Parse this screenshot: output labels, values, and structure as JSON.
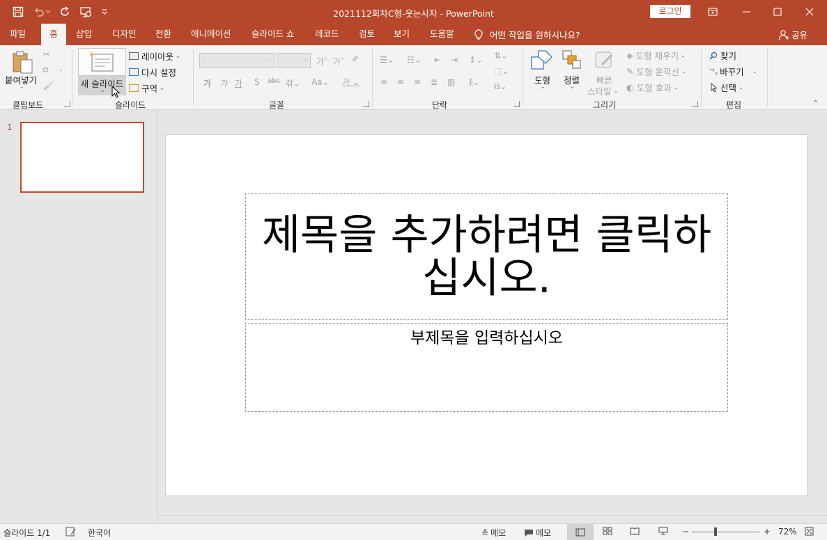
{
  "window": {
    "title": "2021112회차C형-웃는사자  -  PowerPoint",
    "login": "로그인"
  },
  "tabs": [
    {
      "label": "파일"
    },
    {
      "label": "홈"
    },
    {
      "label": "삽입"
    },
    {
      "label": "디자인"
    },
    {
      "label": "전환"
    },
    {
      "label": "애니메이션"
    },
    {
      "label": "슬라이드 쇼"
    },
    {
      "label": "레코드"
    },
    {
      "label": "검토"
    },
    {
      "label": "보기"
    },
    {
      "label": "도움말"
    }
  ],
  "active_tab": "홈",
  "tell_me": "어떤 작업을 원하시나요?",
  "share": "공유",
  "ribbon": {
    "clipboard": {
      "paste": "붙여넣기",
      "group": "클립보드"
    },
    "slides": {
      "new_slide": "새 슬라이드",
      "layout": "레이아웃",
      "reset": "다시 설정",
      "section": "구역",
      "group": "슬라이드"
    },
    "font": {
      "group": "글꼴"
    },
    "paragraph": {
      "group": "단락"
    },
    "drawing": {
      "shapes": "도형",
      "arrange": "정렬",
      "quick_styles_1": "빠른",
      "quick_styles_2": "스타일",
      "fill": "도형 채우기",
      "outline": "도형 윤곽선",
      "effects": "도형 효과",
      "group": "그리기"
    },
    "editing": {
      "find": "찾기",
      "replace": "바꾸기",
      "select": "선택",
      "group": "편집"
    }
  },
  "thumbnails": {
    "slide_number": "1"
  },
  "slide": {
    "title_placeholder": "제목을 추가하려면 클릭하십시오.",
    "subtitle_placeholder": "부제목을 입력하십시오"
  },
  "status": {
    "slide_info": "슬라이드 1/1",
    "language": "한국어",
    "notes": "메모",
    "comments": "메모",
    "zoom": "72%"
  },
  "colors": {
    "accent": "#b7472a",
    "ribbon_bg": "#f3f3f3",
    "workspace_bg": "#e6e6e6"
  }
}
